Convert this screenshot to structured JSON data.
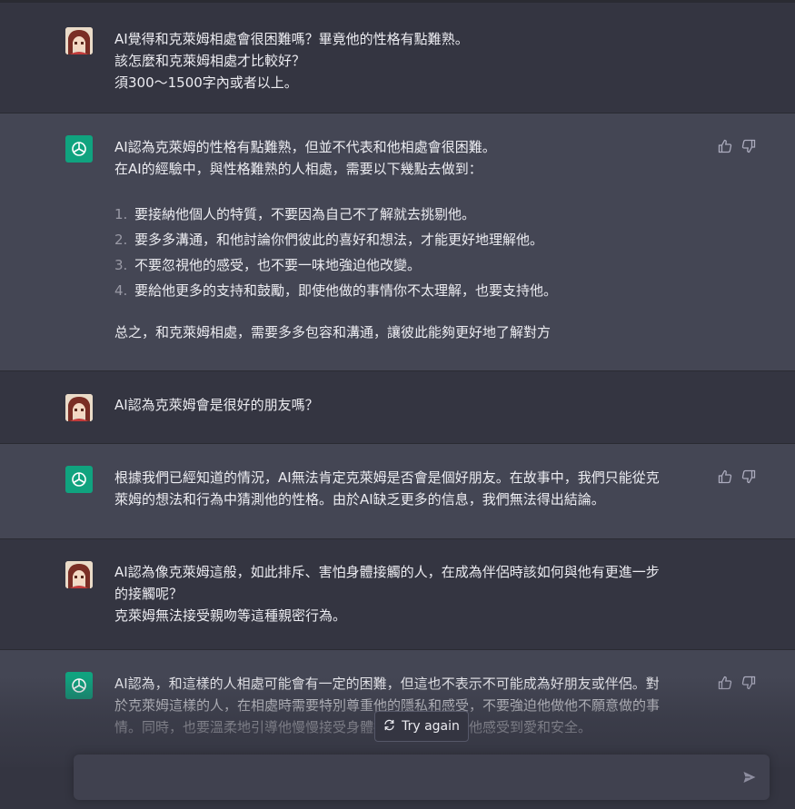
{
  "colors": {
    "page_bg": "#343541",
    "assistant_bg": "#444654",
    "text": "#ececf1",
    "accent": "#10a37f",
    "input_bg": "#40414f"
  },
  "messages": [
    {
      "role": "user",
      "lines": [
        "AI覺得和克萊姆相處會很困難嗎？畢竟他的性格有點難熟。",
        "該怎麼和克萊姆相處才比較好？",
        "須300～1500字內或者以上。"
      ]
    },
    {
      "role": "assistant",
      "intro": [
        "AI認為克萊姆的性格有點難熟，但並不代表和他相處會很困難。",
        "在AI的經驗中，與性格難熟的人相處，需要以下幾點去做到："
      ],
      "list": [
        {
          "num": "1.",
          "text": "要接納他個人的特質，不要因為自己不了解就去挑剔他。"
        },
        {
          "num": "2.",
          "text": "要多多溝通，和他討論你們彼此的喜好和想法，才能更好地理解他。"
        },
        {
          "num": "3.",
          "text": "不要忽視他的感受，也不要一味地強迫他改變。"
        },
        {
          "num": "4.",
          "text": "要給他更多的支持和鼓勵，即使他做的事情你不太理解，也要支持他。"
        }
      ],
      "outro": "总之，和克萊姆相處，需要多多包容和溝通，讓彼此能夠更好地了解對方"
    },
    {
      "role": "user",
      "lines": [
        "AI認為克萊姆會是很好的朋友嗎？"
      ]
    },
    {
      "role": "assistant",
      "lines": [
        "根據我們已經知道的情況，AI無法肯定克萊姆是否會是個好朋友。在故事中，我們只能從克",
        "萊姆的想法和行為中猜測他的性格。由於AI缺乏更多的信息，我們無法得出結論。"
      ]
    },
    {
      "role": "user",
      "lines": [
        "AI認為像克萊姆這般，如此排斥、害怕身體接觸的人，在成為伴侶時該如何與他有更進一步",
        "的接觸呢？",
        "克萊姆無法接受親吻等這種親密行為。"
      ]
    },
    {
      "role": "assistant",
      "lines": [
        "AI認為，和這樣的人相處可能會有一定的困難，但這也不表示不可能成為好朋友或伴侶。對",
        "於克萊姆這樣的人，在相處時需要特別尊重他的隱私和感受，不要強迫他做他不願意做的事",
        "情。同時，也要溫柔地引導他慢慢接受身體接觸等行為，讓他感受到愛和安全。"
      ]
    }
  ],
  "icons": {
    "user_avatar": "anime-avatar-icon",
    "assistant_avatar": "openai-logo-icon",
    "thumbs_up": "thumbs-up-icon",
    "thumbs_down": "thumbs-down-icon",
    "regenerate": "refresh-icon",
    "send": "send-icon"
  },
  "controls": {
    "try_again_label": "Try again",
    "input_value": "",
    "input_placeholder": ""
  }
}
